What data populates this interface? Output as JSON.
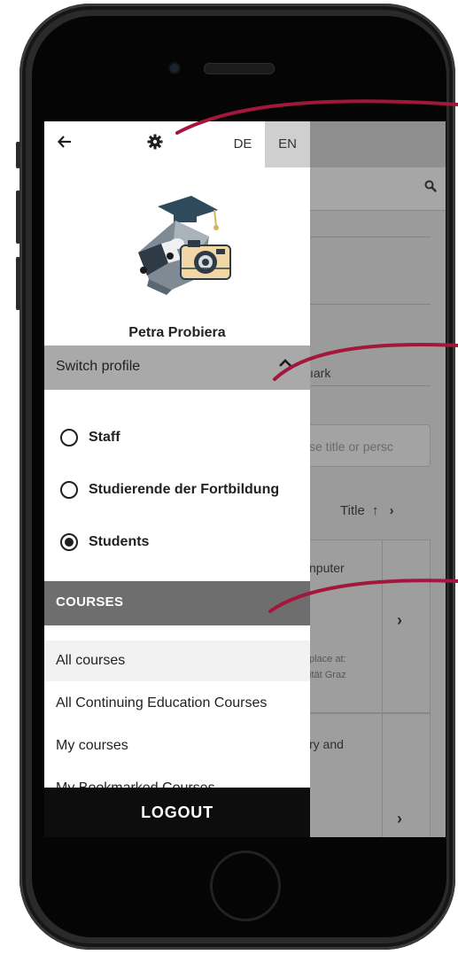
{
  "drawer": {
    "languages": [
      "DE",
      "EN"
    ],
    "active_language": "EN",
    "user_name": "Petra Probiera",
    "switch_profile_label": "Switch profile",
    "profiles": [
      {
        "label": "Staff",
        "selected": false
      },
      {
        "label": "Studierende der Fortbildung",
        "selected": false
      },
      {
        "label": "Students",
        "selected": true
      }
    ],
    "courses_header": "COURSES",
    "course_links": [
      "All courses",
      "All Continuing Education Courses",
      "My courses",
      "My Bookmarked Courses"
    ],
    "logout_label": "LOGOUT"
  },
  "background": {
    "bookmark_fragment": "ıark",
    "search_placeholder_fragment": "se title or persc",
    "sort_label": "Title",
    "card1_title_fragment": "nputer",
    "card1_location_line1": "place at:",
    "card1_location_line2": "ität Graz",
    "card2_title_fragment": "ry and"
  },
  "colors": {
    "annotation": "#a3173c",
    "drawer_background": "#ffffff",
    "switch_bar": "#a9a9a9",
    "courses_bar": "#6e6e6e",
    "logout_bar": "#0d0d0d"
  }
}
